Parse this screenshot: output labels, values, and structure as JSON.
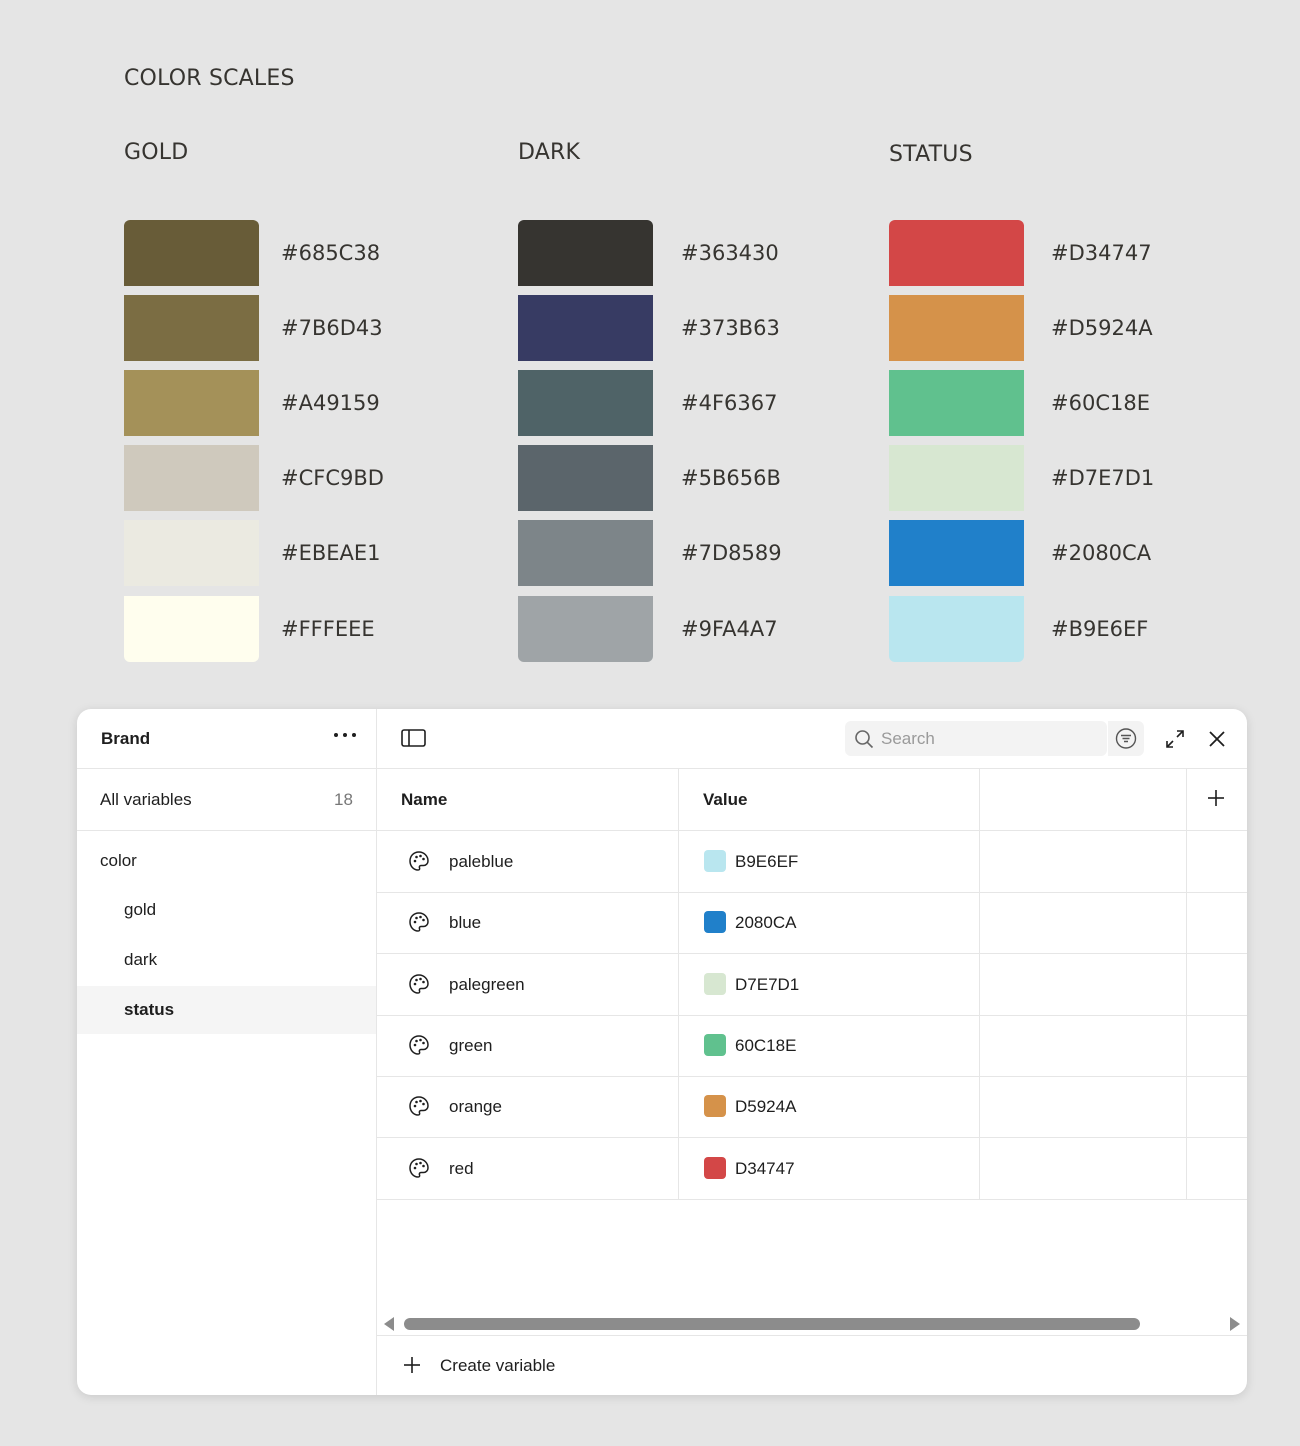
{
  "page": {
    "title": "COLOR SCALES"
  },
  "scales": [
    {
      "name": "GOLD",
      "swatches": [
        {
          "hex": "#685C38",
          "color": "#685C38"
        },
        {
          "hex": "#7B6D43",
          "color": "#7B6D43"
        },
        {
          "hex": "#A49159",
          "color": "#A49159"
        },
        {
          "hex": "#CFC9BD",
          "color": "#CFC9BD"
        },
        {
          "hex": "#EBEAE1",
          "color": "#EBEAE1"
        },
        {
          "hex": "#FFFEEE",
          "color": "#FFFEEE"
        }
      ]
    },
    {
      "name": "DARK",
      "swatches": [
        {
          "hex": "#363430",
          "color": "#363430"
        },
        {
          "hex": "#373B63",
          "color": "#373B63"
        },
        {
          "hex": "#4F6367",
          "color": "#4F6367"
        },
        {
          "hex": "#5B656B",
          "color": "#5B656B"
        },
        {
          "hex": "#7D8589",
          "color": "#7D8589"
        },
        {
          "hex": "#9FA4A7",
          "color": "#9FA4A7"
        }
      ]
    },
    {
      "name": "STATUS",
      "swatches": [
        {
          "hex": "#D34747",
          "color": "#D34747"
        },
        {
          "hex": "#D5924A",
          "color": "#D5924A"
        },
        {
          "hex": "#60C18E",
          "color": "#60C18E"
        },
        {
          "hex": "#D7E7D1",
          "color": "#D7E7D1"
        },
        {
          "hex": "#2080CA",
          "color": "#2080CA"
        },
        {
          "hex": "#B9E6EF",
          "color": "#B9E6EF"
        }
      ]
    }
  ],
  "panel": {
    "collection": "Brand",
    "all_variables_label": "All variables",
    "all_variables_count": "18",
    "group_label": "color",
    "groups": [
      "gold",
      "dark",
      "status"
    ],
    "active_group": "status",
    "search_placeholder": "Search",
    "columns": {
      "name": "Name",
      "value": "Value"
    },
    "rows": [
      {
        "name": "paleblue",
        "value": "B9E6EF",
        "color": "#B9E6EF"
      },
      {
        "name": "blue",
        "value": "2080CA",
        "color": "#2080CA"
      },
      {
        "name": "palegreen",
        "value": "D7E7D1",
        "color": "#D7E7D1"
      },
      {
        "name": "green",
        "value": "60C18E",
        "color": "#60C18E"
      },
      {
        "name": "orange",
        "value": "D5924A",
        "color": "#D5924A"
      },
      {
        "name": "red",
        "value": "D34747",
        "color": "#D34747"
      }
    ],
    "create_label": "Create variable",
    "icons": [
      "more-icon",
      "sidebar-toggle-icon",
      "search-icon",
      "filter-icon",
      "expand-icon",
      "close-icon",
      "plus-icon",
      "palette-icon",
      "scroll-left-icon",
      "scroll-right-icon"
    ]
  }
}
